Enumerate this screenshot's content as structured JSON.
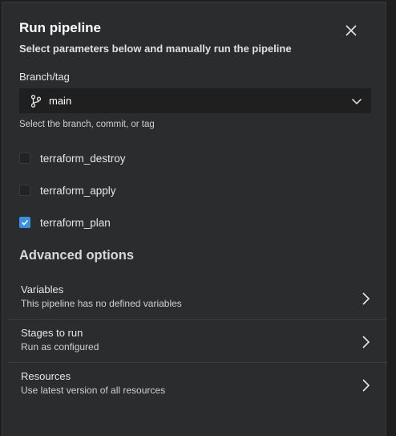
{
  "dialog": {
    "title": "Run pipeline",
    "subtitle": "Select parameters below and manually run the pipeline",
    "close_icon": "close-icon"
  },
  "branch": {
    "label": "Branch/tag",
    "value": "main",
    "icon": "branch-icon",
    "help": "Select the branch, commit, or tag"
  },
  "parameters": [
    {
      "label": "terraform_destroy",
      "checked": false
    },
    {
      "label": "terraform_apply",
      "checked": false
    },
    {
      "label": "terraform_plan",
      "checked": true
    }
  ],
  "advanced": {
    "heading": "Advanced options",
    "options": [
      {
        "title": "Variables",
        "description": "This pipeline has no defined variables"
      },
      {
        "title": "Stages to run",
        "description": "Run as configured"
      },
      {
        "title": "Resources",
        "description": "Use latest version of all resources"
      }
    ]
  },
  "colors": {
    "panel": "#2b2c2e",
    "accent": "#3b8ee0",
    "input_bg": "#1f1f1f"
  }
}
